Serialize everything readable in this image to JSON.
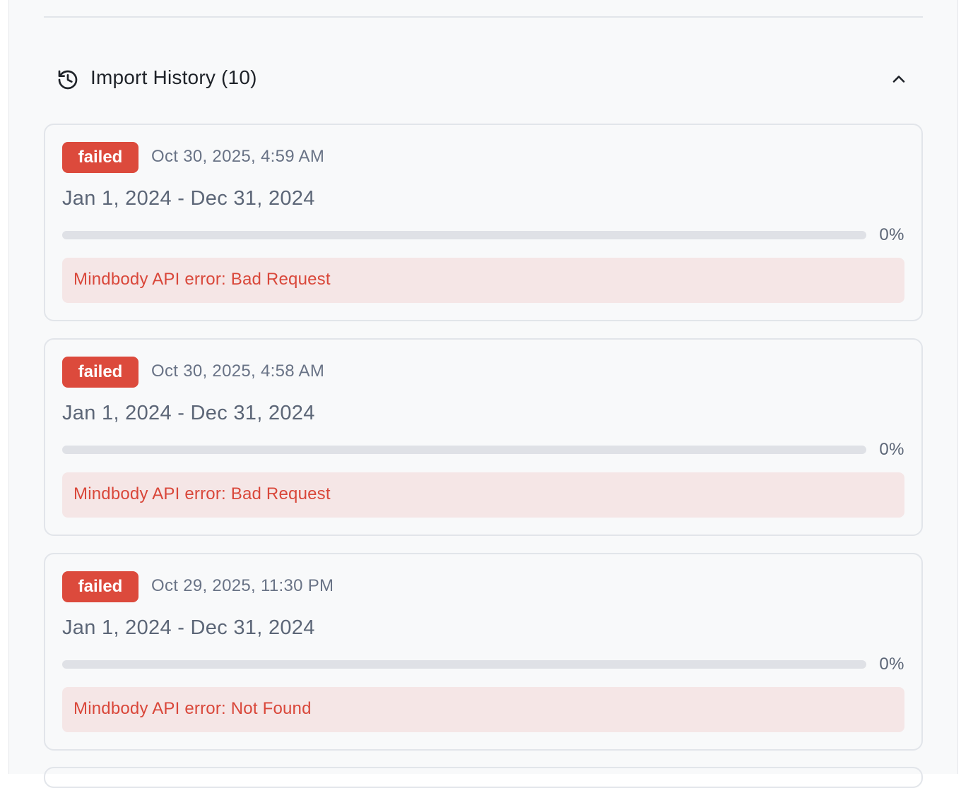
{
  "import_history": {
    "title": "Import History (10)",
    "icon": "history-icon",
    "toggle_icon": "chevron-up-icon",
    "imports": [
      {
        "status": "failed",
        "timestamp": "Oct 30, 2025, 4:59 AM",
        "date_range": "Jan 1, 2024 - Dec 31, 2024",
        "progress_value": 0,
        "progress_label": "0%",
        "error": "Mindbody API error: Bad Request"
      },
      {
        "status": "failed",
        "timestamp": "Oct 30, 2025, 4:58 AM",
        "date_range": "Jan 1, 2024 - Dec 31, 2024",
        "progress_value": 0,
        "progress_label": "0%",
        "error": "Mindbody API error: Bad Request"
      },
      {
        "status": "failed",
        "timestamp": "Oct 29, 2025, 11:30 PM",
        "date_range": "Jan 1, 2024 - Dec 31, 2024",
        "progress_value": 0,
        "progress_label": "0%",
        "error": "Mindbody API error: Not Found"
      }
    ]
  },
  "colors": {
    "failed_badge": "#dc4a3c",
    "error_text": "#d9473a",
    "error_background": "#f5e6e6",
    "panel_background": "#f8f9fa"
  }
}
